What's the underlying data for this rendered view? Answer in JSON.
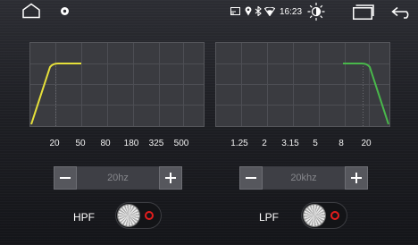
{
  "status_bar": {
    "time": "16:23",
    "icons": [
      "home-icon",
      "settings-icon",
      "screencast-icon",
      "location-pin-icon",
      "bluetooth-icon",
      "wifi-icon",
      "brightness-icon",
      "recent-apps-icon",
      "back-icon"
    ]
  },
  "colors": {
    "hpf_curve": "#e6e03a",
    "lpf_curve": "#49b84b",
    "toggle_ring": "#e21d1d"
  },
  "hpf": {
    "label": "HPF",
    "value": "20hz",
    "enabled": false,
    "ticks": [
      "20",
      "50",
      "80",
      "180",
      "325",
      "500"
    ]
  },
  "lpf": {
    "label": "LPF",
    "value": "20khz",
    "enabled": false,
    "ticks": [
      "1.25",
      "2",
      "3.15",
      "5",
      "8",
      "20"
    ]
  }
}
